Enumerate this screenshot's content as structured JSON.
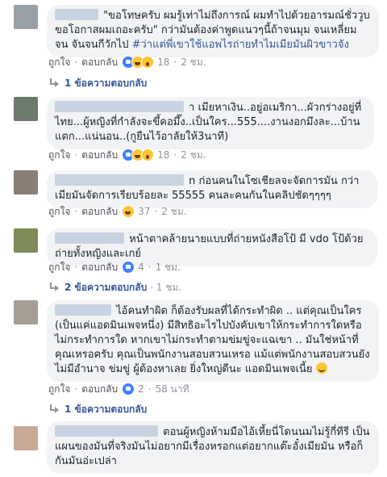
{
  "comments": [
    {
      "text": "\"ขอโทษครับ ผมรู้เท่าไม่ถึงการณ์ ผมทำไปด้วยอารมณ์ชั่ววูบ ขอโอกาสผมเถอะครับ\" กว่ามันต้องค่าพูดแนวๆนี้ถ้าจนมุม จนเหลี่ยม จน จันจนกีวักไป ",
      "hashtag": "#ว่าแต่พี่เขาใช้แอพไรถ่ายทำไมเมียมันผิวขาวจัง",
      "like_label": "ถูกใจ",
      "reply_label": "ตอบกลับ",
      "reaction_count": "18",
      "time": "2 ชม.",
      "reactions": [
        "like",
        "haha",
        "wow"
      ],
      "replies_label": "1 ข้อความตอบกลับ",
      "replies_time": ""
    },
    {
      "text": "า เมียหาเงิน..อยู่อเมริกา...ผัวกร่างอยู่ที่ไทย...ผู้หญิงที่กำลังจะขึ้คอมึ๊ง..เป็นใคร...555....งานงอกมึงละ...บ้านแตก...แน่นอน..(กูยืนไว้อาลัยให้3นาที)",
      "like_label": "ถูกใจ",
      "reply_label": "ตอบกลับ",
      "reaction_count": "18",
      "time": "2 ชม.",
      "reactions": [
        "like",
        "haha",
        "wow"
      ]
    },
    {
      "text": "n ก่อนคนในโซเชียลจะจัดการมัน กว่าเมียมันจัดการเรียบร้อยละ 55555 คนละคนกันในคลิปชัดๆๆๆๆ",
      "like_label": "ถูกใจ",
      "reply_label": "ตอบกลับ",
      "reaction_count": "37",
      "time": "2 ชม.",
      "reactions": [
        "haha"
      ]
    },
    {
      "text": "หน้าตาคล้ายนายแบบที่ถ่ายหนังสือโป้ มี vdo โป้ด้วย ถ่ายทั้งหญิงและเกย์",
      "like_label": "ถูกใจ",
      "reply_label": "ตอบกลับ",
      "reaction_count": "4",
      "time": "1 ชม.",
      "reactions": [
        "like"
      ],
      "replies_label": "2 ข้อความตอบกลับ",
      "replies_time": "· 1 ชม."
    },
    {
      "text": "ไอ้คนทำผิด ก็ต้องรับผลที่ได้กระทำผิด .. แต่คุณเป็นใคร (เป็นแค่แอดมินเพจหนึ่ง) มีสิทธิอะไรไปบังคับเขาให้กระทำการใดหรือไม่กระทำการใด หากเขาไม่กระทำตามข่มขู่จะแฉเขา .. มันใช่หน้าที่คุณเหรอครับ คุณเป็นพนักงานสอบสวนเหรอ แม้แต่พนักงานสอบสวนยังไม่มีอำนาจ ข่มขู่ ผู้ต้องหาเลย ยิ่งใหญ่ดีนะ แอดมินเพจเนี้ย ",
      "like_label": "ถูกใจ",
      "reply_label": "ตอบกลับ",
      "reaction_count": "2",
      "time": "58 นาที",
      "reactions": [
        "like"
      ],
      "replies_label": "1 ข้อความตอบกลับ",
      "replies_time": ""
    },
    {
      "text": "ตอนผู้หญิงห้ามมือไอ้เหี้ยนี่โดนนมไม่รู้กี่ทีรี เป็นแผนของมันที่จริงมันไม่อยากมีเรื่องหรอกแต่อยากแต๊ะอั๋งเมียมัน หรือก็กันมันอ่ะเปล่า"
    }
  ]
}
